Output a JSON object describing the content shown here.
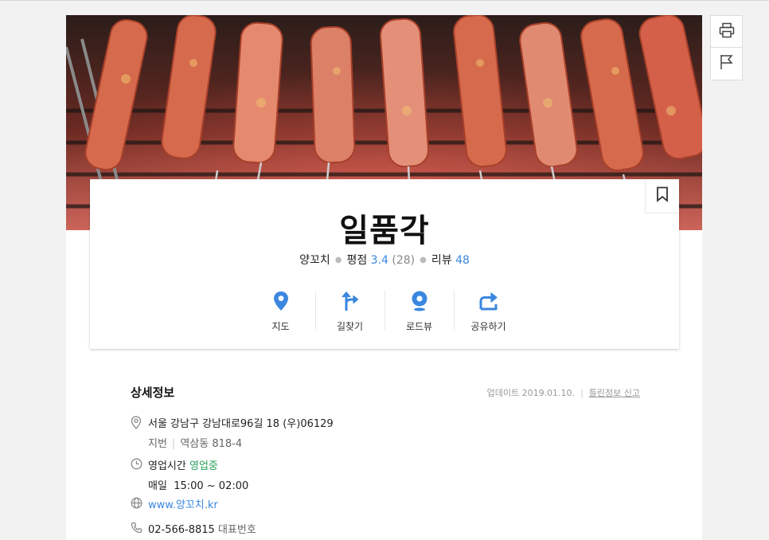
{
  "place": {
    "name": "일품각",
    "category": "양꼬치",
    "rating_label": "평점",
    "rating_value": "3.4",
    "rating_count": "(28)",
    "review_label": "리뷰",
    "review_count": "48"
  },
  "side_tools": [
    {
      "icon": "printer-icon"
    },
    {
      "icon": "flag-icon"
    }
  ],
  "actions": [
    {
      "label": "지도",
      "icon": "map-pin-icon"
    },
    {
      "label": "길찾기",
      "icon": "directions-icon"
    },
    {
      "label": "로드뷰",
      "icon": "roadview-icon"
    },
    {
      "label": "공유하기",
      "icon": "share-icon"
    }
  ],
  "detail": {
    "title": "상세정보",
    "updated": "업데이트 2019.01.10.",
    "report_link": "틀린정보 신고",
    "address": "서울 강남구 강남대로96길 18 (우)06129",
    "jibun_label": "지번",
    "jibun_value": "역삼동 818-4",
    "hours_label": "영업시간",
    "hours_status": "영업중",
    "hours_days": "매일",
    "hours_time": "15:00 ~ 02:00",
    "website": "www.양꼬치.kr",
    "phone": "02-566-8815",
    "phone_label": "대표번호"
  },
  "colors": {
    "accent_blue": "#3b87e0",
    "open_green": "#2aa05a"
  }
}
